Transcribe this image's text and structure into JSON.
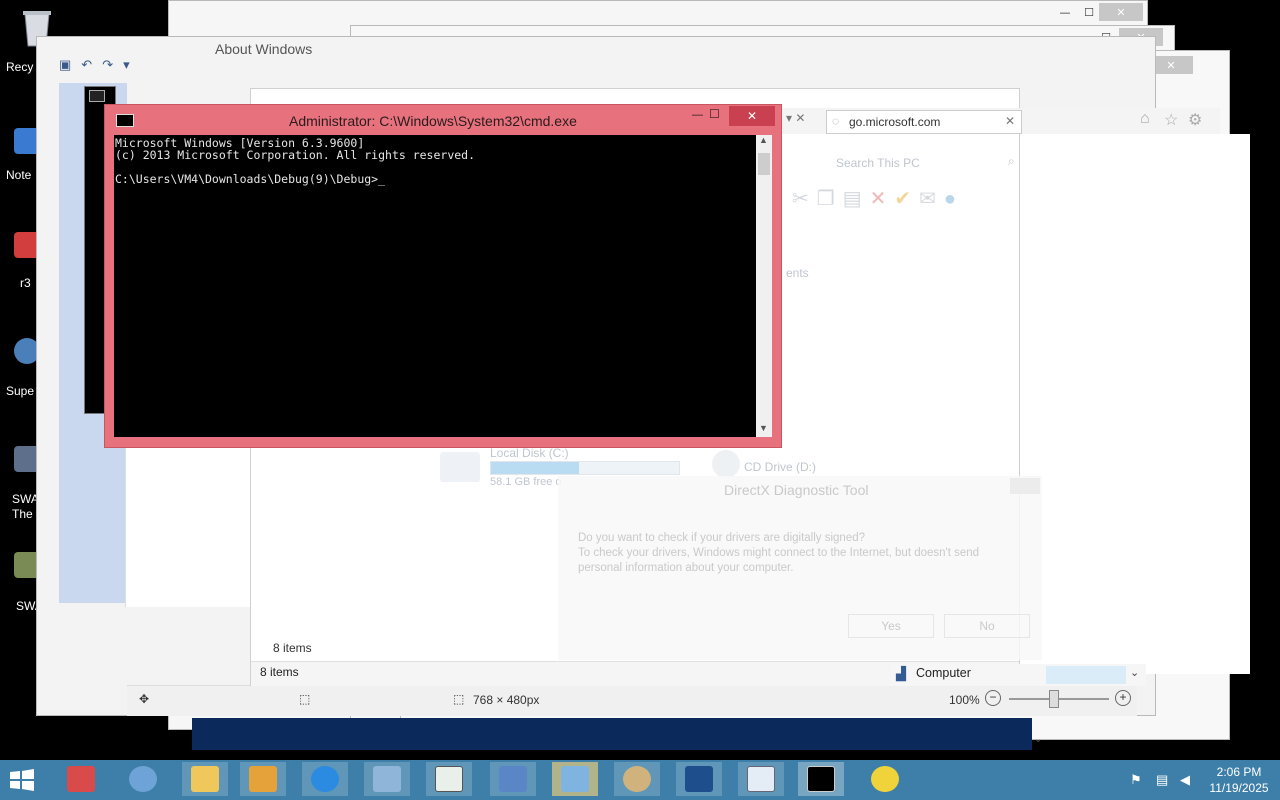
{
  "desktop": {
    "icons": [
      {
        "label": "Recy",
        "name": "recycle-bin"
      },
      {
        "label": "Note",
        "name": "notepad"
      },
      {
        "label": "r3",
        "name": "r3"
      },
      {
        "label": "Supe",
        "name": "supe"
      },
      {
        "label": "SWA\nThe S",
        "name": "swat-1"
      },
      {
        "label": "SWA",
        "name": "swat-2"
      }
    ]
  },
  "about_windows": {
    "title": "About Windows"
  },
  "explorer": {
    "search_placeholder": "Search This PC",
    "local_disk": "Local Disk (C:)",
    "local_disk_free": "58.1 GB free o",
    "cd_drive": "CD Drive (D:)",
    "items_count_1": "8 items",
    "items_count_2": "8 items",
    "computer_label": "Computer",
    "partial_text": "ents"
  },
  "browser": {
    "address": "go.microsoft.com"
  },
  "paint": {
    "image_size": "768 × 480px",
    "zoom": "100%"
  },
  "directx": {
    "title": "DirectX Diagnostic Tool",
    "question": "Do you want to check if your drivers are digitally signed?",
    "detail": "To check your drivers, Windows might connect to the Internet, but doesn't send personal information about your computer.",
    "yes": "Yes",
    "no": "No"
  },
  "cmd": {
    "title": "Administrator: C:\\Windows\\System32\\cmd.exe",
    "line1": "Microsoft Windows [Version 6.3.9600]",
    "line2": "(c) 2013 Microsoft Corporation. All rights reserved.",
    "prompt": "C:\\Users\\VM4\\Downloads\\Debug(9)\\Debug>",
    "border_color": "#e7717d",
    "bg_color": "#000000"
  },
  "taskbar": {
    "time": "2:06 PM",
    "date": "11/19/2025",
    "apps": [
      "toolbox",
      "browser-globe",
      "file-explorer",
      "app-window",
      "internet-explorer",
      "notepad-book",
      "window-app",
      "monitor-app",
      "control-panel",
      "paint-app",
      "powershell",
      "image-viewer",
      "command-prompt",
      "xbox-tool"
    ]
  }
}
